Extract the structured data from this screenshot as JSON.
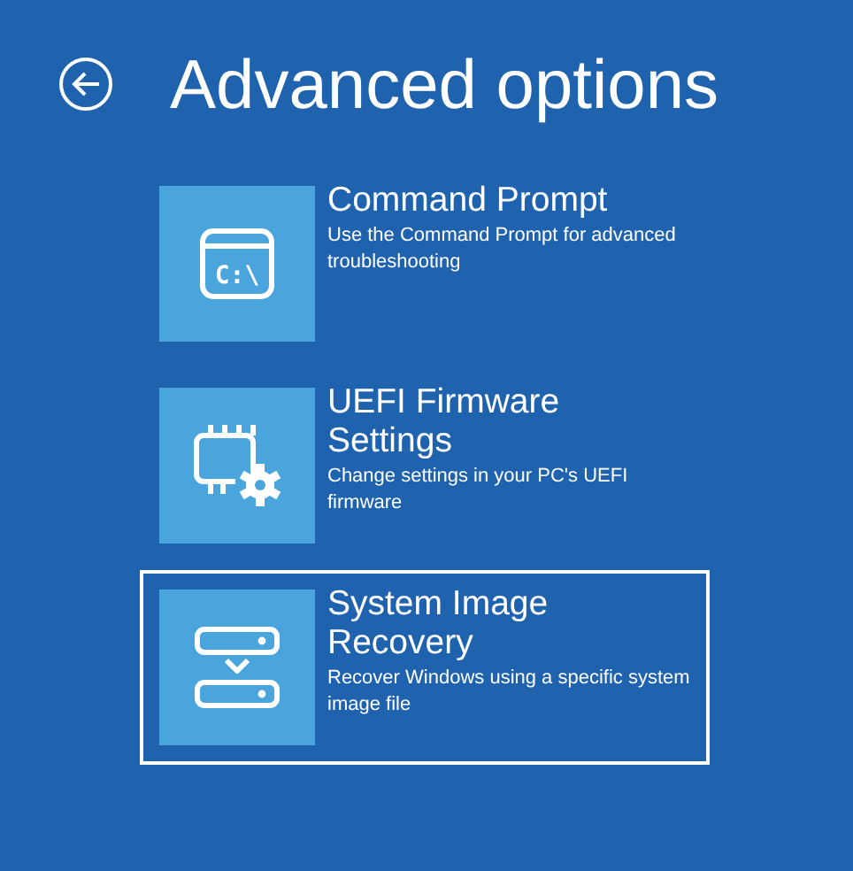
{
  "title": "Advanced options",
  "options": [
    {
      "kind": "terminal",
      "icon_text": "C:\\",
      "title": "Command Prompt",
      "description": "Use the Command Prompt for advanced troubleshooting",
      "selected": false
    },
    {
      "kind": "firmware",
      "title": "UEFI Firmware Settings",
      "description": "Change settings in your PC's UEFI firmware",
      "selected": false
    },
    {
      "kind": "image",
      "title": "System Image Recovery",
      "description": "Recover Windows using a specific system image file",
      "selected": true
    }
  ]
}
